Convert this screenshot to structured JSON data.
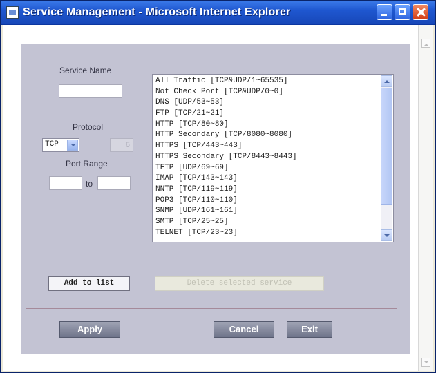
{
  "window": {
    "title": "Service Management - Microsoft Internet Explorer"
  },
  "form": {
    "service_name_label": "Service Name",
    "service_name_value": "",
    "protocol_label": "Protocol",
    "protocol_selected": "TCP",
    "protocol_number_value": "6",
    "port_range_label": "Port Range",
    "port_range_from": "",
    "port_range_to_label": "to",
    "port_range_to": ""
  },
  "services_list": [
    "All Traffic [TCP&UDP/1~65535]",
    "Not Check Port [TCP&UDP/0~0]",
    "DNS [UDP/53~53]",
    "FTP [TCP/21~21]",
    "HTTP [TCP/80~80]",
    "HTTP Secondary [TCP/8080~8080]",
    "HTTPS [TCP/443~443]",
    "HTTPS Secondary [TCP/8443~8443]",
    "TFTP [UDP/69~69]",
    "IMAP [TCP/143~143]",
    "NNTP [TCP/119~119]",
    "POP3 [TCP/110~110]",
    "SNMP [UDP/161~161]",
    "SMTP [TCP/25~25]",
    "TELNET [TCP/23~23]"
  ],
  "buttons": {
    "add_to_list": "Add to list",
    "delete_selected": "Delete selected service",
    "apply": "Apply",
    "cancel": "Cancel",
    "exit": "Exit"
  }
}
